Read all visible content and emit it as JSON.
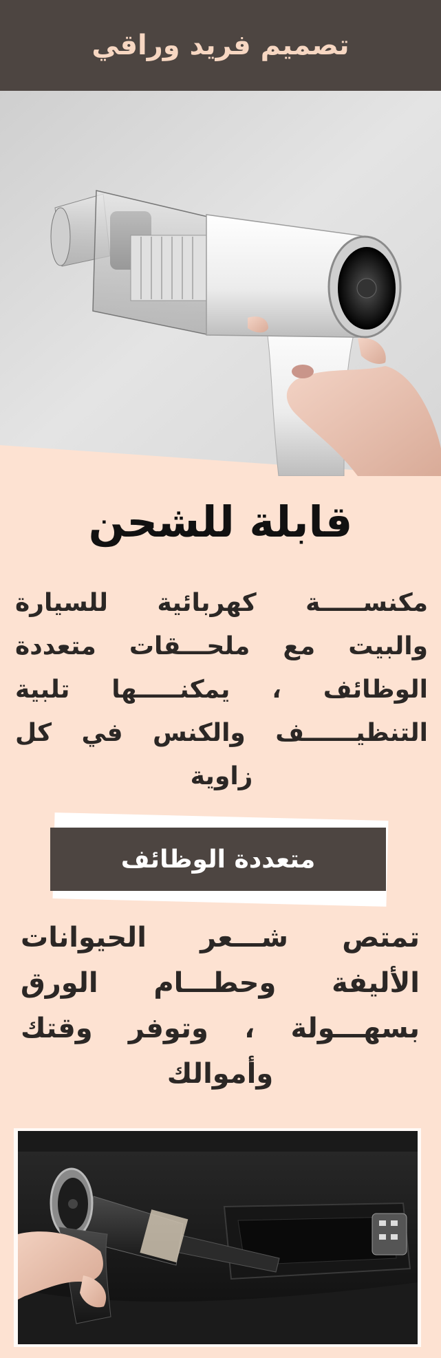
{
  "header": {
    "title": "تصميم فريد وراقي"
  },
  "hero": {
    "subject": "vacuum-product-photo"
  },
  "section1": {
    "heading": "قابلة للشحن",
    "description": "مكنســـــة كهربائية للسيارة والبيت مع ملحـــقات متعددة الوظائف ، يمكنـــــها تلبية التنظيــــــف والكنس في كل زاوية"
  },
  "banner": {
    "label": "متعددة الوظائف"
  },
  "section2": {
    "description": "تمتص شـــعر الحيوانات الأليفة وحطـــام الورق بسهـــولة ، وتوفر وقتك وأموالك"
  },
  "colors": {
    "dark": "#4d4541",
    "peach": "#fde2d2",
    "header_text": "#f7d7c2"
  }
}
